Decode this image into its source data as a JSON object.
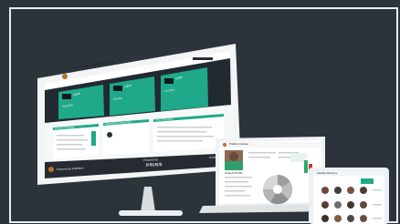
{
  "monitor": {
    "header_title": "Prabhu Institute of Technology Portal",
    "stat_cards": [
      {
        "value": "2,430",
        "label": "Students"
      },
      {
        "value": "1,234",
        "label": "Faculty"
      },
      {
        "value": "1,230",
        "label": "Courses"
      }
    ],
    "panels": [
      {
        "title": "Recent Activities"
      },
      {
        "title": "Attendance Summary"
      },
      {
        "title": "Fee Collection"
      }
    ],
    "footer_left": "Powered by Institution",
    "footer_center_small": "Powered by",
    "footer_brand": "PRINS",
    "footer_right": "Contact us"
  },
  "laptop": {
    "header_title": "Prabhu Institute",
    "profile_name": "Student Profile"
  },
  "tablet": {
    "header_title": "Faculty Directory"
  },
  "colors": {
    "background": "#2c333b",
    "frame": "#e9eef2",
    "accent_teal": "#1fa98a",
    "accent_brown": "#6b3f1d"
  }
}
